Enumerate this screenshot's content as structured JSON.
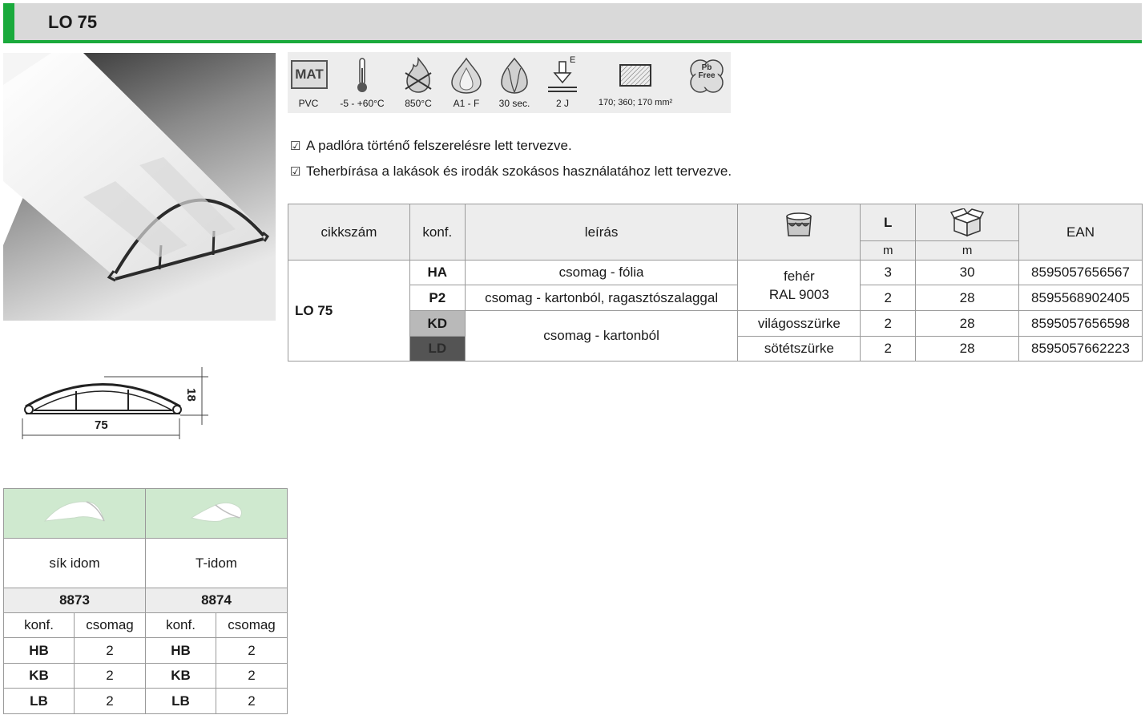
{
  "header": {
    "title": "LO 75"
  },
  "specs": [
    {
      "icon": "mat-icon",
      "badge": "MAT",
      "label": "PVC"
    },
    {
      "icon": "thermometer-icon",
      "label": "-5 - +60°C"
    },
    {
      "icon": "flame-wire-icon",
      "label": "850°C"
    },
    {
      "icon": "flame-drop-icon",
      "label": "A1 - F"
    },
    {
      "icon": "flame-duration-icon",
      "label": "30 sec."
    },
    {
      "icon": "impact-icon",
      "badge": "E",
      "label": "2 J"
    },
    {
      "icon": "cross-section-icon",
      "label": "170; 360; 170 mm²"
    },
    {
      "icon": "pb-free-icon",
      "badge": "Pb Free",
      "badge_top": "Pb",
      "badge_bottom": "Free",
      "label": ""
    }
  ],
  "features": [
    "A padlóra történő felszerelésre lett tervezve.",
    "Teherbírása a lakások és irodák szokásos használatához lett tervezve."
  ],
  "drawing": {
    "width": "75",
    "height": "18"
  },
  "table": {
    "headers": {
      "article": "cikkszám",
      "config": "konf.",
      "description": "leírás",
      "color_icon": "paint-bucket-icon",
      "length": "L",
      "length_unit": "m",
      "package_icon": "box-icon",
      "package_unit": "m",
      "ean": "EAN"
    },
    "article": "LO 75",
    "rows": [
      {
        "config": "HA",
        "description": "csomag - fólia",
        "color": "fehér\nRAL 9003",
        "length": "3",
        "package": "30",
        "ean": "8595057656567"
      },
      {
        "config": "P2",
        "description": "csomag - kartonból, ragasztószalaggal",
        "color": "",
        "length": "2",
        "package": "28",
        "ean": "8595568902405"
      },
      {
        "config": "KD",
        "description": "csomag - kartonból",
        "color": "világosszürke",
        "length": "2",
        "package": "28",
        "ean": "8595057656598"
      },
      {
        "config": "LD",
        "description": "",
        "color": "sötétszürke",
        "length": "2",
        "package": "28",
        "ean": "8595057662223"
      }
    ],
    "colors": {
      "white_top": "fehér",
      "white_bottom": "RAL 9003",
      "kd_bg": "#b9b9b9",
      "ld_bg": "#545454"
    }
  },
  "accessories": {
    "items": [
      {
        "name": "sík idom",
        "code": "8873",
        "icon": "flat-joint-icon"
      },
      {
        "name": "T-idom",
        "code": "8874",
        "icon": "t-joint-icon"
      }
    ],
    "headers": {
      "config": "konf.",
      "pack": "csomag"
    },
    "rows": [
      {
        "a_config": "HB",
        "a_pack": "2",
        "b_config": "HB",
        "b_pack": "2"
      },
      {
        "a_config": "KB",
        "a_pack": "2",
        "b_config": "KB",
        "b_pack": "2"
      },
      {
        "a_config": "LB",
        "a_pack": "2",
        "b_config": "LB",
        "b_pack": "2"
      }
    ]
  }
}
